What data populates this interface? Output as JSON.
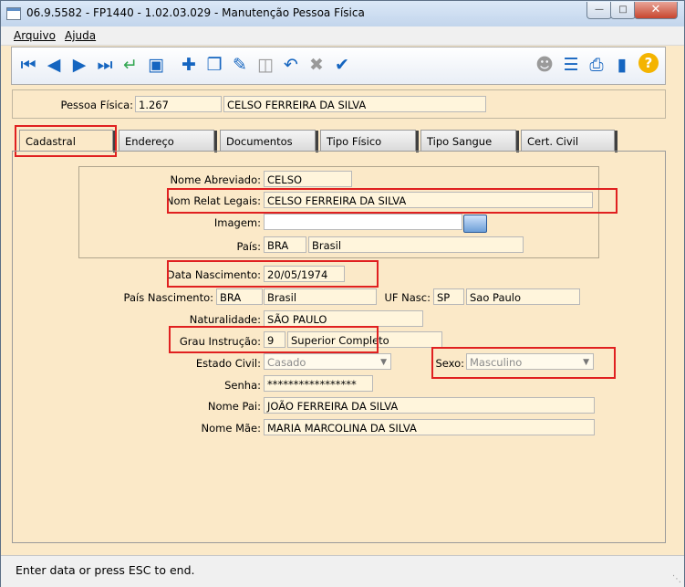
{
  "window": {
    "title": "06.9.5582 - FP1440 - 1.02.03.029 - Manutenção Pessoa Física"
  },
  "menu": {
    "arquivo": "Arquivo",
    "ajuda": "Ajuda"
  },
  "toolbar": {
    "icons": [
      "first-icon",
      "prev-icon",
      "next-icon",
      "last-icon",
      "enter-icon",
      "search-icon",
      "new-icon",
      "copy-icon",
      "edit-icon",
      "delete-icon",
      "undo-icon",
      "cancel-icon",
      "confirm-icon",
      "user-icon",
      "tree-icon",
      "print-icon",
      "exit-icon",
      "help-icon"
    ]
  },
  "header": {
    "label": "Pessoa Física:",
    "code": "1.267",
    "name": "CELSO FERREIRA DA SILVA"
  },
  "tabs": [
    "Cadastral",
    "Endereço",
    "Documentos",
    "Tipo Físico",
    "Tipo Sangue",
    "Cert. Civil"
  ],
  "form": {
    "nome_abreviado": {
      "label": "Nome Abreviado:",
      "value": "CELSO"
    },
    "nom_relat": {
      "label": "Nom Relat Legais:",
      "value": "CELSO FERREIRA DA SILVA"
    },
    "imagem": {
      "label": "Imagem:",
      "value": ""
    },
    "pais": {
      "label": "País:",
      "code": "BRA",
      "name": "Brasil"
    },
    "data_nascimento": {
      "label": "Data Nascimento:",
      "value": "20/05/1974"
    },
    "pais_nascimento": {
      "label": "País Nascimento:",
      "code": "BRA",
      "name": "Brasil"
    },
    "uf_nasc": {
      "label": "UF Nasc:",
      "code": "SP",
      "name": "Sao Paulo"
    },
    "naturalidade": {
      "label": "Naturalidade:",
      "value": "SÃO PAULO"
    },
    "grau_instrucao": {
      "label": "Grau Instrução:",
      "code": "9",
      "name": "Superior Completo"
    },
    "estado_civil": {
      "label": "Estado Civil:",
      "value": "Casado"
    },
    "sexo": {
      "label": "Sexo:",
      "value": "Masculino"
    },
    "senha": {
      "label": "Senha:",
      "value": "*****************"
    },
    "nome_pai": {
      "label": "Nome Pai:",
      "value": "JOÃO FERREIRA DA SILVA"
    },
    "nome_mae": {
      "label": "Nome Mãe:",
      "value": "MARIA MARCOLINA DA SILVA"
    }
  },
  "status": {
    "text": "Enter data or press ESC to end."
  },
  "colors": {
    "panel": "#fbe9c8",
    "field": "#fff5dc",
    "highlight": "#e02020",
    "toolbar_icon": "#1565c0"
  }
}
